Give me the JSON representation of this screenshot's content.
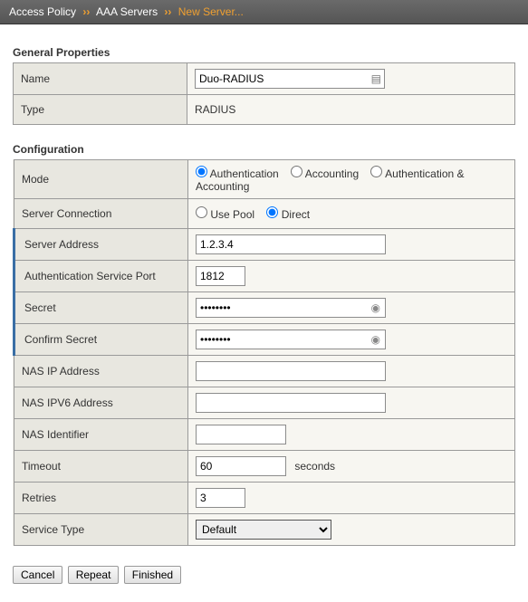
{
  "breadcrumb": {
    "level1": "Access Policy",
    "level2": "AAA Servers",
    "level3": "New Server..."
  },
  "general": {
    "title": "General Properties",
    "name_label": "Name",
    "name_value": "Duo-RADIUS",
    "type_label": "Type",
    "type_value": "RADIUS"
  },
  "config": {
    "title": "Configuration",
    "mode_label": "Mode",
    "mode_options": {
      "auth": "Authentication",
      "acct": "Accounting",
      "both": "Authentication & Accounting"
    },
    "mode_selected": "auth",
    "conn_label": "Server Connection",
    "conn_options": {
      "pool": "Use Pool",
      "direct": "Direct"
    },
    "conn_selected": "direct",
    "server_address_label": "Server Address",
    "server_address_value": "1.2.3.4",
    "auth_port_label": "Authentication Service Port",
    "auth_port_value": "1812",
    "secret_label": "Secret",
    "secret_value": "••••••••",
    "confirm_secret_label": "Confirm Secret",
    "confirm_secret_value": "••••••••",
    "nas_ip_label": "NAS IP Address",
    "nas_ip_value": "",
    "nas_ipv6_label": "NAS IPV6 Address",
    "nas_ipv6_value": "",
    "nas_id_label": "NAS Identifier",
    "nas_id_value": "",
    "timeout_label": "Timeout",
    "timeout_value": "60",
    "timeout_unit": "seconds",
    "retries_label": "Retries",
    "retries_value": "3",
    "service_type_label": "Service Type",
    "service_type_value": "Default"
  },
  "buttons": {
    "cancel": "Cancel",
    "repeat": "Repeat",
    "finished": "Finished"
  }
}
